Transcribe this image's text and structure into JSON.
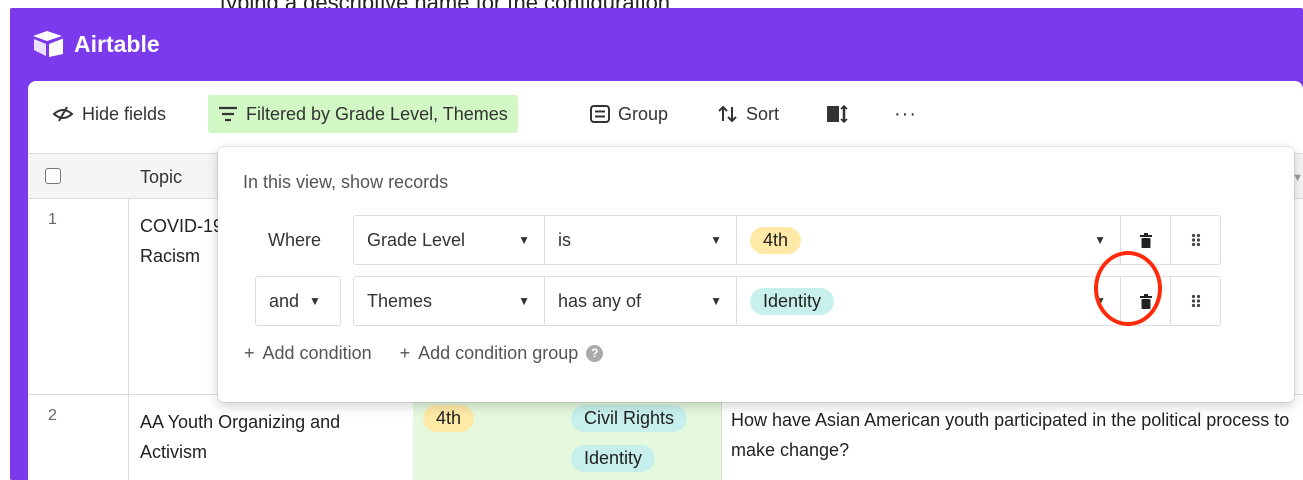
{
  "caption": "typing a descriptive name for the configuration",
  "app": {
    "brand": "Airtable"
  },
  "toolbar": {
    "hide_fields": "Hide fields",
    "filter": "Filtered by Grade Level, Themes",
    "group": "Group",
    "sort": "Sort",
    "more": "···"
  },
  "grid": {
    "column_topic": "Topic",
    "rows": [
      {
        "num": "1",
        "topic": "COVID-19, Responding to Racism",
        "grade": "",
        "themes": [],
        "question": ""
      },
      {
        "num": "2",
        "topic": "AA Youth Organizing and Activism",
        "grade": "4th",
        "themes": [
          "Civil Rights",
          "Identity"
        ],
        "question": "How have Asian American youth  participated in the political process to make change?"
      }
    ]
  },
  "filter_popover": {
    "title": "In this view, show records",
    "conditions": [
      {
        "conjunction": "Where",
        "field": "Grade Level",
        "operator": "is",
        "value": "4th"
      },
      {
        "conjunction": "and",
        "field": "Themes",
        "operator": "has any of",
        "value": "Identity"
      }
    ],
    "add_condition": "Add condition",
    "add_condition_group": "Add condition group"
  },
  "colors": {
    "brand_purple": "#7c3aed",
    "filter_active_green": "#d1f7c4",
    "pill_yellow": "#ffe9a6",
    "pill_teal": "#c7f0ec",
    "annotation_red": "#ff2a0a"
  }
}
